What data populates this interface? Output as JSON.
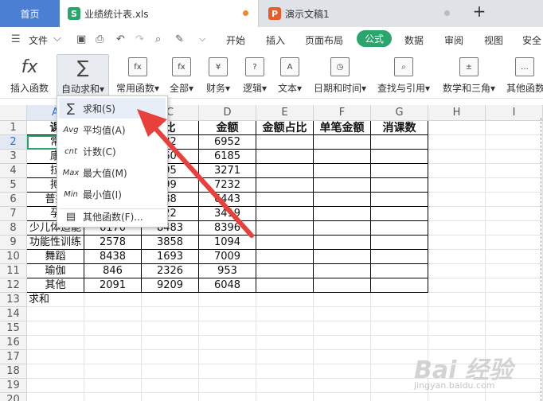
{
  "tabs": {
    "home": "首页",
    "file1": {
      "badge": "S",
      "name": "业绩统计表.xls"
    },
    "file2": {
      "badge": "P",
      "name": "演示文稿1"
    },
    "add": "+"
  },
  "menu": {
    "hamburger": "☰",
    "file": "文件",
    "file_caret": "⌵",
    "items": [
      "开始",
      "插入",
      "页面布局",
      "公式",
      "数据",
      "审阅",
      "视图",
      "安全"
    ],
    "active": "公式",
    "more": "⌵"
  },
  "ribbon": {
    "buttons": [
      {
        "label": "插入函数",
        "icon": "fx"
      },
      {
        "label": "自动求和▾",
        "icon": "∑"
      },
      {
        "label": "常用函数▾",
        "icon": "fx"
      },
      {
        "label": "全部▾",
        "icon": "fx"
      },
      {
        "label": "财务▾",
        "icon": "¥"
      },
      {
        "label": "逻辑▾",
        "icon": "?"
      },
      {
        "label": "文本▾",
        "icon": "A"
      },
      {
        "label": "日期和时间▾",
        "icon": "◷"
      },
      {
        "label": "查找与引用▾",
        "icon": "⌕"
      },
      {
        "label": "数学和三角▾",
        "icon": "±"
      },
      {
        "label": "其他函数",
        "icon": "…"
      }
    ]
  },
  "columns": [
    "A",
    "B",
    "C",
    "D",
    "E",
    "F",
    "G",
    "H",
    "I"
  ],
  "rows": [
    "1",
    "2",
    "3",
    "4",
    "5",
    "6",
    "7",
    "8",
    "9",
    "10",
    "11",
    "12",
    "13",
    "14",
    "15",
    "16",
    "17",
    "18",
    "19",
    "20"
  ],
  "sheet": {
    "header": [
      "课",
      "",
      "比",
      "金额",
      "金额占比",
      "单笔金额",
      "消课数"
    ],
    "data": [
      [
        "常",
        "",
        "82",
        "6952"
      ],
      [
        "康",
        "",
        "60",
        "6185"
      ],
      [
        "拉",
        "",
        "95",
        "3271"
      ],
      [
        "搏",
        "",
        "99",
        "7232"
      ],
      [
        "普拉",
        "",
        "88",
        "6443"
      ],
      [
        "孕",
        "",
        "22",
        "3419"
      ],
      [
        "少儿体适能",
        "6170",
        "8483",
        "8396"
      ],
      [
        "功能性训练",
        "2578",
        "3858",
        "1094"
      ],
      [
        "舞蹈",
        "8438",
        "1693",
        "7009"
      ],
      [
        "瑜伽",
        "846",
        "2326",
        "953"
      ],
      [
        "其他",
        "2091",
        "9209",
        "6048"
      ]
    ],
    "row13": "求和"
  },
  "dropdown": {
    "items": [
      {
        "icon": "∑",
        "label": "求和(S)"
      },
      {
        "icon": "Avg",
        "label": "平均值(A)"
      },
      {
        "icon": "cnt",
        "label": "计数(C)"
      },
      {
        "icon": "Max",
        "label": "最大值(M)"
      },
      {
        "icon": "Min",
        "label": "最小值(I)"
      },
      {
        "icon": "▤",
        "label": "其他函数(F)..."
      }
    ]
  },
  "watermark": {
    "text": "Bai 经验",
    "sub": "jingyan.baidu.com"
  },
  "colors": {
    "accent": "#2aa56b",
    "home_tab": "#4a7fd4",
    "arrow": "#e8413c"
  }
}
